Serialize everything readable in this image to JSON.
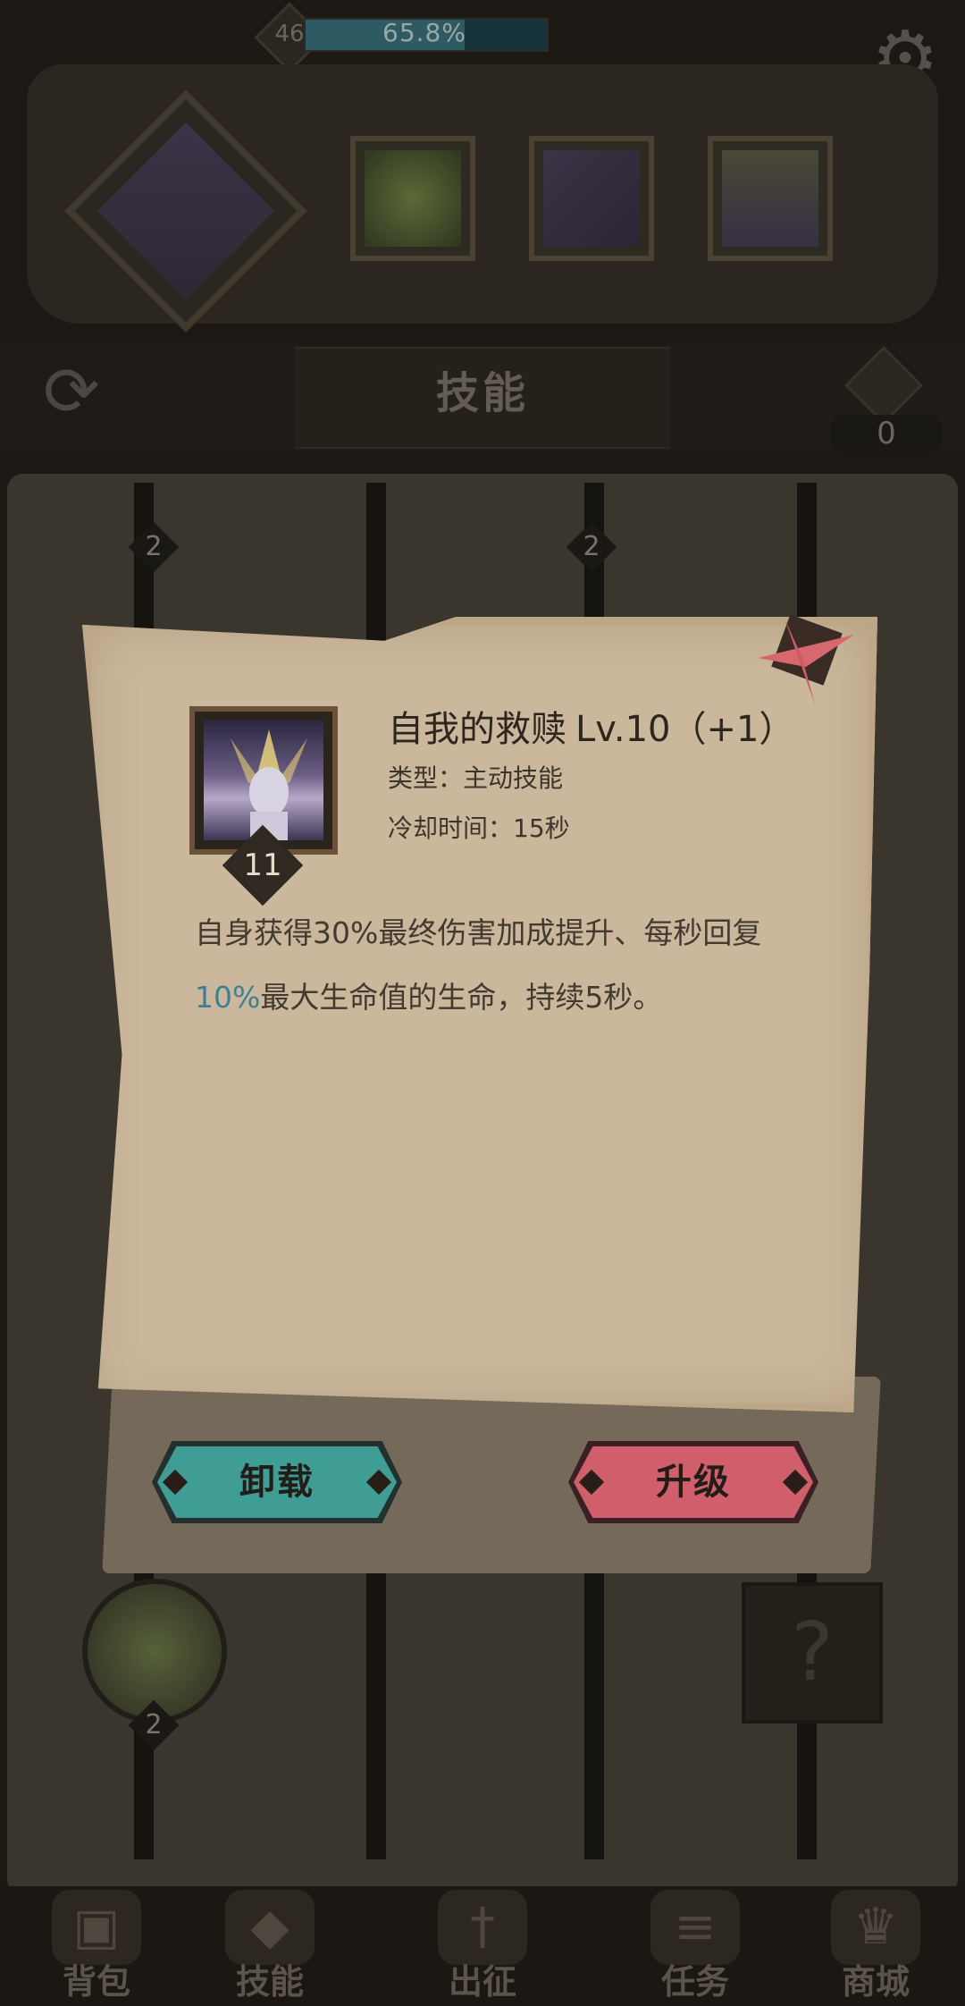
{
  "top_bar": {
    "level": "46",
    "xp_percent_text": "65.8%",
    "xp_fraction": 0.658,
    "settings_icon": "gear-icon"
  },
  "header": {
    "title": "技能",
    "gem_count": "0"
  },
  "board": {
    "node_counts": [
      "2",
      "2",
      "2"
    ]
  },
  "dialog": {
    "skill_level_badge": "11",
    "skill_name": "自我的救赎",
    "skill_level": "Lv.10（+1）",
    "type_line": "类型：主动技能",
    "cooldown_line": "冷却时间：15秒",
    "description": {
      "part1": "自身获得30%最终伤害加成提升、每秒回复",
      "highlight": "10%",
      "part2": "最大生命值的生命，持续5秒。"
    },
    "unequip_label": "卸载",
    "upgrade_label": "升级",
    "colors": {
      "highlight": "#3f7f95",
      "unequip_button": "#3f9d95",
      "upgrade_button": "#d05f6b"
    }
  },
  "nav": {
    "items": [
      {
        "label": "背包",
        "icon": "backpack-icon"
      },
      {
        "label": "技能",
        "icon": "skill-book-icon"
      },
      {
        "label": "出征",
        "icon": "sword-icon"
      },
      {
        "label": "任务",
        "icon": "scroll-icon"
      },
      {
        "label": "商城",
        "icon": "shop-icon"
      }
    ]
  }
}
